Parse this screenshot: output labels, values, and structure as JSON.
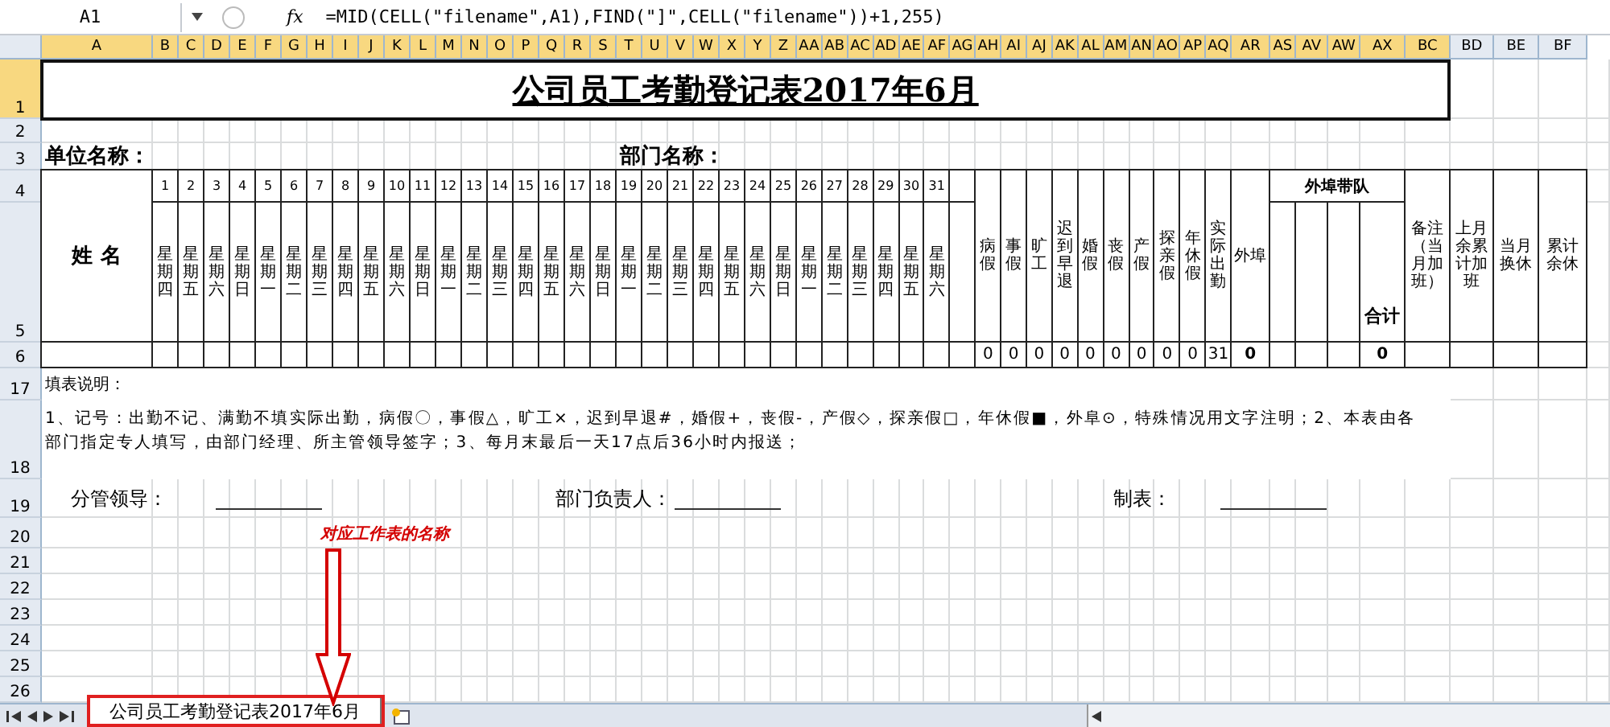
{
  "formula_bar": {
    "name_box": "A1",
    "fx_label": "fx",
    "formula": "=MID(CELL(\"filename\",A1),FIND(\"]\",CELL(\"filename\"))+1,255)"
  },
  "column_headers": [
    {
      "label": "A",
      "selected": true
    },
    {
      "label": "B",
      "selected": true
    },
    {
      "label": "C",
      "selected": true
    },
    {
      "label": "D",
      "selected": true
    },
    {
      "label": "E",
      "selected": true
    },
    {
      "label": "F",
      "selected": true
    },
    {
      "label": "G",
      "selected": true
    },
    {
      "label": "H",
      "selected": true
    },
    {
      "label": "I",
      "selected": true
    },
    {
      "label": "J",
      "selected": true
    },
    {
      "label": "K",
      "selected": true
    },
    {
      "label": "L",
      "selected": true
    },
    {
      "label": "M",
      "selected": true
    },
    {
      "label": "N",
      "selected": true
    },
    {
      "label": "O",
      "selected": true
    },
    {
      "label": "P",
      "selected": true
    },
    {
      "label": "Q",
      "selected": true
    },
    {
      "label": "R",
      "selected": true
    },
    {
      "label": "S",
      "selected": true
    },
    {
      "label": "T",
      "selected": true
    },
    {
      "label": "U",
      "selected": true
    },
    {
      "label": "V",
      "selected": true
    },
    {
      "label": "W",
      "selected": true
    },
    {
      "label": "X",
      "selected": true
    },
    {
      "label": "Y",
      "selected": true
    },
    {
      "label": "Z",
      "selected": true
    },
    {
      "label": "AA",
      "selected": true
    },
    {
      "label": "AB",
      "selected": true
    },
    {
      "label": "AC",
      "selected": true
    },
    {
      "label": "AD",
      "selected": true
    },
    {
      "label": "AE",
      "selected": true
    },
    {
      "label": "AF",
      "selected": true
    },
    {
      "label": "AG",
      "selected": true
    },
    {
      "label": "AH",
      "selected": true
    },
    {
      "label": "AI",
      "selected": true
    },
    {
      "label": "AJ",
      "selected": true
    },
    {
      "label": "AK",
      "selected": true
    },
    {
      "label": "AL",
      "selected": true
    },
    {
      "label": "AM",
      "selected": true
    },
    {
      "label": "AN",
      "selected": true
    },
    {
      "label": "AO",
      "selected": true
    },
    {
      "label": "AP",
      "selected": true
    },
    {
      "label": "AQ",
      "selected": true
    },
    {
      "label": "AR",
      "selected": true
    },
    {
      "label": "AS",
      "selected": true
    },
    {
      "label": "AV",
      "selected": true
    },
    {
      "label": "AW",
      "selected": true
    },
    {
      "label": "AX",
      "selected": true
    },
    {
      "label": "BC",
      "selected": true
    },
    {
      "label": "BD",
      "selected": false
    },
    {
      "label": "BE",
      "selected": false
    },
    {
      "label": "BF",
      "selected": false
    }
  ],
  "row_headers": [
    {
      "label": "1",
      "selected": true
    },
    {
      "label": "2",
      "selected": false
    },
    {
      "label": "3",
      "selected": false
    },
    {
      "label": "4",
      "selected": false
    },
    {
      "label": "5",
      "selected": false
    },
    {
      "label": "6",
      "selected": false
    },
    {
      "label": "17",
      "selected": false
    },
    {
      "label": "18",
      "selected": false
    },
    {
      "label": "19",
      "selected": false
    },
    {
      "label": "20",
      "selected": false
    },
    {
      "label": "21",
      "selected": false
    },
    {
      "label": "22",
      "selected": false
    },
    {
      "label": "23",
      "selected": false
    },
    {
      "label": "24",
      "selected": false
    },
    {
      "label": "25",
      "selected": false
    },
    {
      "label": "26",
      "selected": false
    }
  ],
  "title": "公司员工考勤登记表2017年6月",
  "unit_label": "单位名称：",
  "dept_label": "部门名称：",
  "name_header": "姓 名",
  "days": [
    {
      "day": "1",
      "weekday": "星期四"
    },
    {
      "day": "2",
      "weekday": "星期五"
    },
    {
      "day": "3",
      "weekday": "星期六"
    },
    {
      "day": "4",
      "weekday": "星期日"
    },
    {
      "day": "5",
      "weekday": "星期一"
    },
    {
      "day": "6",
      "weekday": "星期二"
    },
    {
      "day": "7",
      "weekday": "星期三"
    },
    {
      "day": "8",
      "weekday": "星期四"
    },
    {
      "day": "9",
      "weekday": "星期五"
    },
    {
      "day": "10",
      "weekday": "星期六"
    },
    {
      "day": "11",
      "weekday": "星期日"
    },
    {
      "day": "12",
      "weekday": "星期一"
    },
    {
      "day": "13",
      "weekday": "星期二"
    },
    {
      "day": "14",
      "weekday": "星期三"
    },
    {
      "day": "15",
      "weekday": "星期四"
    },
    {
      "day": "16",
      "weekday": "星期五"
    },
    {
      "day": "17",
      "weekday": "星期六"
    },
    {
      "day": "18",
      "weekday": "星期日"
    },
    {
      "day": "19",
      "weekday": "星期一"
    },
    {
      "day": "20",
      "weekday": "星期二"
    },
    {
      "day": "21",
      "weekday": "星期三"
    },
    {
      "day": "22",
      "weekday": "星期四"
    },
    {
      "day": "23",
      "weekday": "星期五"
    },
    {
      "day": "24",
      "weekday": "星期六"
    },
    {
      "day": "25",
      "weekday": "星期日"
    },
    {
      "day": "26",
      "weekday": "星期一"
    },
    {
      "day": "27",
      "weekday": "星期二"
    },
    {
      "day": "28",
      "weekday": "星期三"
    },
    {
      "day": "29",
      "weekday": "星期四"
    },
    {
      "day": "30",
      "weekday": "星期五"
    },
    {
      "day": "31",
      "weekday": "星期六"
    }
  ],
  "leave_columns": [
    {
      "label": "病假",
      "value": "0"
    },
    {
      "label": "事假",
      "value": "0"
    },
    {
      "label": "旷工",
      "value": "0"
    },
    {
      "label": "迟到早退",
      "value": "0"
    },
    {
      "label": "婚假",
      "value": "0"
    },
    {
      "label": "丧假",
      "value": "0"
    },
    {
      "label": "产假",
      "value": "0"
    },
    {
      "label": "探亲假",
      "value": "0"
    },
    {
      "label": "年休假",
      "value": "0"
    },
    {
      "label": "实际出勤",
      "value": "31"
    }
  ],
  "outside": {
    "label": "外埠",
    "value": "0"
  },
  "team": {
    "label": "外埠带队",
    "total_label": "合计",
    "total_value": "0"
  },
  "extra_columns": [
    "备注（当月加班）",
    "上月余累计加班",
    "当月换休",
    "累计余休"
  ],
  "notes_title": "填表说明：",
  "notes": "1、记号：出勤不记、满勤不填实际出勤，病假〇，事假△，旷工×，迟到早退#，婚假+，丧假-，产假◇，探亲假□，年休假■，外阜⊙，特殊情况用文字注明；2、本表由各部门指定专人填写，由部门经理、所主管领导签字；3、每月末最后一天17点后36小时内报送；",
  "signatures": [
    "分管领导：",
    "部门负责人：",
    "制表："
  ],
  "annotation": "对应工作表的名称",
  "sheet_tabs": [
    {
      "label": "公司员工考勤登记表2017年6月",
      "selected": true
    }
  ]
}
